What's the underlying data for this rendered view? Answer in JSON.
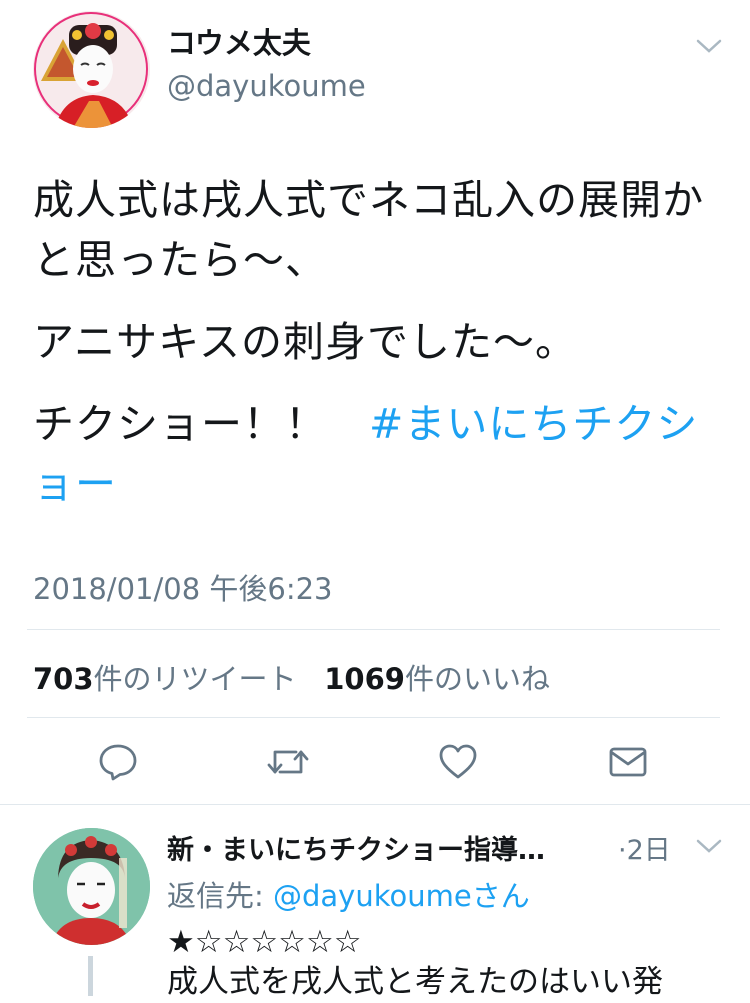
{
  "tweet": {
    "display_name": "コウメ太夫",
    "handle": "@dayukoume",
    "paragraphs": [
      "成人式は戌人式でネコ乱入の展開かと思ったら〜、",
      "アニサキスの刺身でした〜。"
    ],
    "last_text": "チクショー！！　",
    "hashtag": "#まいにちチクショー",
    "timestamp": "2018/01/08 午後6:23",
    "retweet_count": "703",
    "retweet_label": "件のリツイート",
    "like_count": "1069",
    "like_label": "件のいいね"
  },
  "reply": {
    "display_name": "新・まいにちチクショー指導…",
    "time": "·2日",
    "reply_to_label": "返信先: ",
    "reply_to_handle": "@dayukoume",
    "reply_to_suffix": "さん",
    "rating": "★☆☆☆☆☆☆",
    "text": "成人式を戌人式と考えたのはいい発"
  },
  "icons": [
    "chevron-down-icon",
    "reply-icon",
    "retweet-icon",
    "like-icon",
    "dm-icon"
  ],
  "colors": {
    "link": "#1da1f2",
    "muted": "#657786",
    "divider": "#e1e8ed"
  }
}
